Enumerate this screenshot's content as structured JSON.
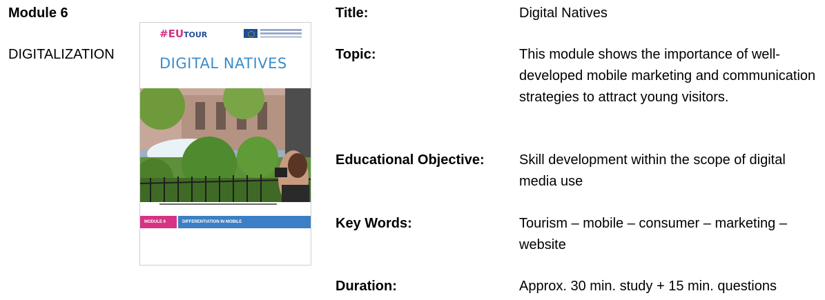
{
  "module": {
    "heading": "Module 6",
    "subject": "DIGITALIZATION"
  },
  "cover": {
    "logo_hash": "#",
    "logo_eu": "EU",
    "logo_tour": "TOUR",
    "title": "DIGITAL NATIVES",
    "band_left": "MODULE 6",
    "band_right": "DIFFERENTIATION IN MOBILE"
  },
  "info": {
    "title_label": "Title:",
    "title_value": "Digital Natives",
    "topic_label": "Topic:",
    "topic_value": "This module shows the importance of well-developed mobile marketing and communication strategies to attract young visitors.",
    "objective_label": "Educational Objective:",
    "objective_value": "Skill development within the scope of digital media use",
    "keywords_label": "Key Words:",
    "keywords_value": "Tourism – mobile – consumer – marketing – website",
    "duration_label": "Duration:",
    "duration_value": "Approx. 30 min. study + 15 min. questions"
  },
  "colors": {
    "accent_pink": "#d63384",
    "accent_blue": "#3b7fc4",
    "title_blue": "#3b8cc9"
  }
}
